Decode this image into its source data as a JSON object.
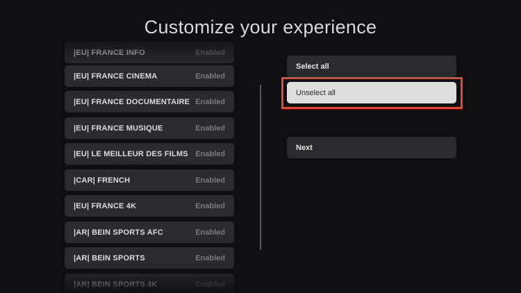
{
  "header": {
    "title": "Customize your experience"
  },
  "channels": [
    {
      "name": "|EU| FRANCE INFO",
      "status": "Enabled"
    },
    {
      "name": "|EU| FRANCE CINEMA",
      "status": "Enabled"
    },
    {
      "name": "|EU| FRANCE DOCUMENTAIRE",
      "status": "Enabled"
    },
    {
      "name": "|EU| FRANCE MUSIQUE",
      "status": "Enabled"
    },
    {
      "name": "|EU| LE MEILLEUR DES FILMS",
      "status": "Enabled"
    },
    {
      "name": "|CAR| FRENCH",
      "status": "Enabled"
    },
    {
      "name": "|EU| FRANCE 4K",
      "status": "Enabled"
    },
    {
      "name": "|AR| BEIN SPORTS AFC",
      "status": "Enabled"
    },
    {
      "name": "|AR| BEIN SPORTS",
      "status": "Enabled"
    },
    {
      "name": "|AR| BEIN SPORTS 4K",
      "status": "Enabled"
    }
  ],
  "actions": {
    "select_all": "Select all",
    "unselect_all": "Unselect all",
    "next": "Next"
  },
  "colors": {
    "background": "#0f0f11",
    "item_background": "#2b2b2e",
    "focused_background": "#dedede",
    "highlight": "#e5472a"
  }
}
